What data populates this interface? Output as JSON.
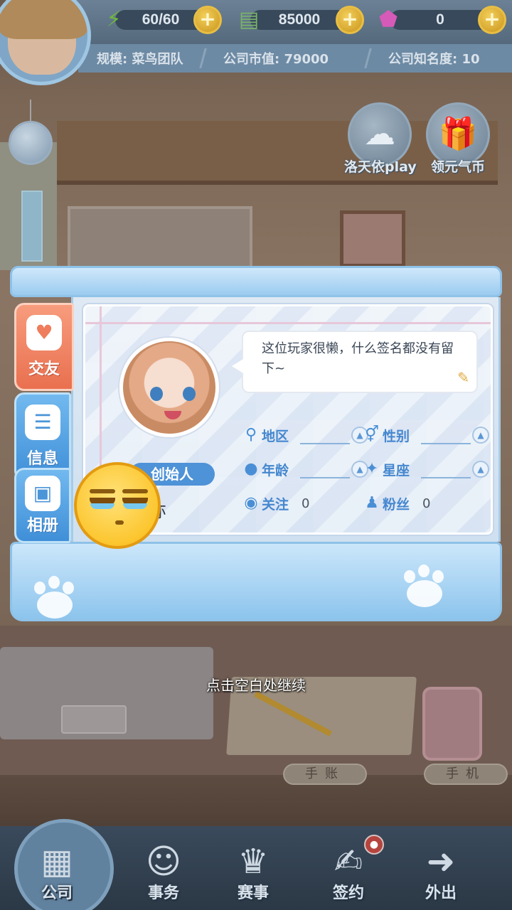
{
  "hud": {
    "energy": "60/60",
    "cash": "85000",
    "gems": "0",
    "plus": "+",
    "scale_label": "规模: 菜鸟团队",
    "market_value_label": "公司市值: 79000",
    "fame_label": "公司知名度: 10"
  },
  "promos": [
    {
      "label": "洛天依play",
      "icon": "mascot-icon"
    },
    {
      "label": "领元气币",
      "icon": "gift-box-icon"
    }
  ],
  "profile": {
    "signature": "这位玩家很懒，什么签名都没有留下~",
    "badge": "创始人",
    "name": "亦",
    "fields": {
      "region_label": "地区",
      "gender_label": "性别",
      "age_label": "年龄",
      "sign_label": "星座",
      "follow_label": "关注",
      "follow_count": "0",
      "fans_label": "粉丝",
      "fans_count": "0"
    }
  },
  "tabs": [
    {
      "label": "交友",
      "icon": "heart-chat-icon"
    },
    {
      "label": "信息",
      "icon": "document-icon"
    },
    {
      "label": "相册",
      "icon": "image-icon"
    }
  ],
  "hint": "点击空白处继续",
  "scene": {
    "notebook_label": "手账",
    "phone_label": "手机"
  },
  "nav": [
    {
      "label": "公司",
      "icon": "company-icon"
    },
    {
      "label": "事务",
      "icon": "affairs-icon"
    },
    {
      "label": "赛事",
      "icon": "trophy-icon"
    },
    {
      "label": "签约",
      "icon": "contract-icon"
    },
    {
      "label": "外出",
      "icon": "door-exit-icon"
    }
  ],
  "colors": {
    "accent_blue": "#4587cf",
    "friends_tab": "#e9704f",
    "founder_badge": "#4e92d7"
  }
}
